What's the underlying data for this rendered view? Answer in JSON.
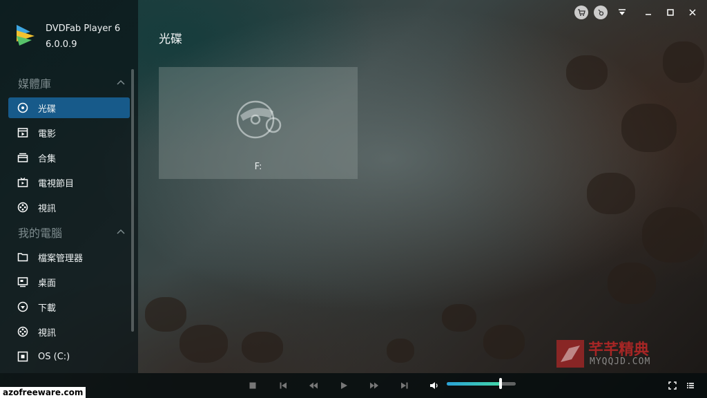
{
  "app": {
    "name": "DVDFab Player 6",
    "version": "6.0.0.9"
  },
  "sidebar": {
    "sections": [
      {
        "title": "媒體庫",
        "items": [
          {
            "label": "光碟",
            "icon": "disc-icon",
            "active": true
          },
          {
            "label": "電影",
            "icon": "movie-icon"
          },
          {
            "label": "合集",
            "icon": "collection-icon"
          },
          {
            "label": "電視節目",
            "icon": "tv-icon"
          },
          {
            "label": "視訊",
            "icon": "video-reel-icon"
          }
        ]
      },
      {
        "title": "我的電腦",
        "items": [
          {
            "label": "檔案管理器",
            "icon": "folder-icon"
          },
          {
            "label": "桌面",
            "icon": "desktop-icon"
          },
          {
            "label": "下載",
            "icon": "download-icon"
          },
          {
            "label": "視訊",
            "icon": "video-reel-icon"
          },
          {
            "label": "OS (C:)",
            "icon": "drive-icon"
          }
        ]
      }
    ]
  },
  "main": {
    "title": "光碟",
    "disc_tile": {
      "drive": "F:",
      "icon": "disc-drive-icon"
    }
  },
  "top_controls": [
    "cart-icon",
    "account-icon",
    "menu-icon",
    "minimize-icon",
    "maximize-icon",
    "close-icon"
  ],
  "player": {
    "volume_level": 0.78,
    "buttons": [
      "stop-icon",
      "previous-icon",
      "rewind-icon",
      "play-icon",
      "fast-forward-icon",
      "next-icon",
      "volume-icon",
      "fullscreen-icon",
      "playlist-icon"
    ]
  },
  "watermarks": {
    "left": "azofreeware.com",
    "right_cn": "芊芊精典",
    "right_en": "MYQQJD.COM"
  },
  "colors": {
    "accent": "#175a8a",
    "volume_start": "#2aa3d8",
    "volume_end": "#43d6a8"
  }
}
